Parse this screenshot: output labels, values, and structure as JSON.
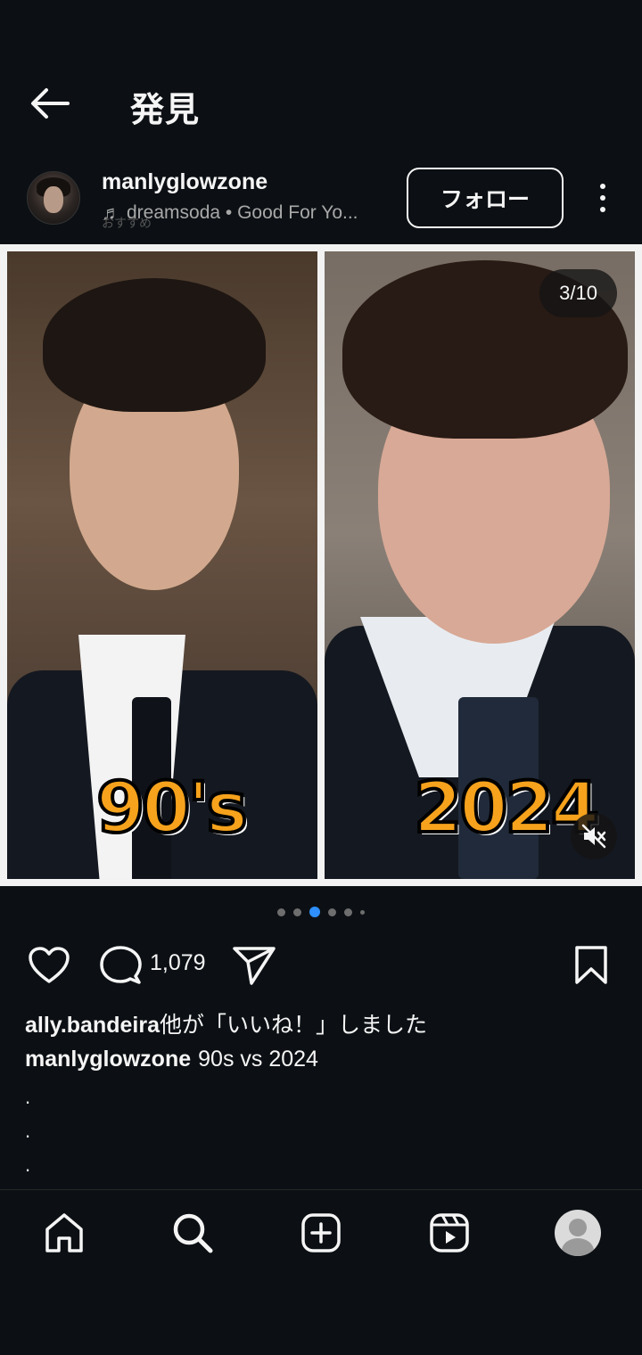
{
  "header": {
    "title": "発見"
  },
  "post": {
    "username": "manlyglowzone",
    "music": "dreamsoda • Good For Yo...",
    "recommend_label": "おすすめ",
    "follow_label": "フォロー",
    "media": {
      "left_label": "90's",
      "right_label": "2024",
      "page_counter": "3/10"
    },
    "comment_count": "1,079",
    "likes_user": "ally.bandeira",
    "likes_suffix": "他が「いいね！」しました",
    "caption_user": "manlyglowzone",
    "caption_text": "90s vs 2024",
    "caption_dots": [
      ".",
      ".",
      "."
    ]
  },
  "colors": {
    "background": "#0c1014",
    "accent": "#2f8fff",
    "text": "#f5f5f5"
  },
  "icons": [
    "back-arrow-icon",
    "music-note-icon",
    "more-vertical-icon",
    "mute-icon",
    "heart-icon",
    "comment-icon",
    "share-icon",
    "bookmark-icon",
    "home-icon",
    "search-icon",
    "create-icon",
    "reels-icon",
    "profile-icon"
  ]
}
